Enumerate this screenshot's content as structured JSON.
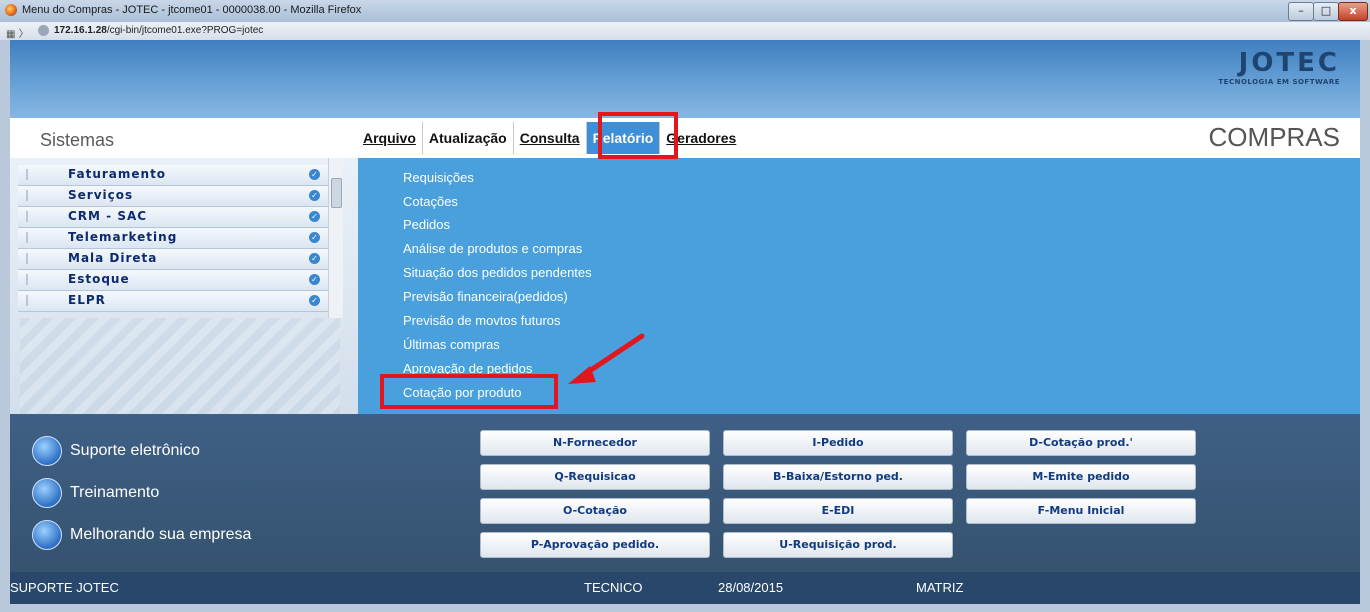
{
  "window": {
    "title": "Menu do Compras - JOTEC - jtcome01 - 0000038.00 - Mozilla Firefox",
    "min_label": "–",
    "max_label": "□",
    "close_label": "x"
  },
  "address": {
    "url_host": "172.16.1.28",
    "url_path": "/cgi-bin/jtcome01.exe?PROG=jotec"
  },
  "brand": {
    "logo": "JOTEC",
    "tagline": "TECNOLOGIA EM SOFTWARE",
    "module": "COMPRAS"
  },
  "sidebar": {
    "title": "Sistemas",
    "items": [
      {
        "label": "Faturamento"
      },
      {
        "label": "Serviços"
      },
      {
        "label": "CRM - SAC"
      },
      {
        "label": "Telemarketing"
      },
      {
        "label": "Mala Direta"
      },
      {
        "label": "Estoque"
      },
      {
        "label": "ELPR"
      }
    ]
  },
  "menu": {
    "items": [
      {
        "label": "Arquivo"
      },
      {
        "label": "Atualização"
      },
      {
        "label": "Consulta"
      },
      {
        "label": "Relatório",
        "active": true
      },
      {
        "label": "Geradores"
      }
    ]
  },
  "dropdown": {
    "items": [
      {
        "label": "Requisições"
      },
      {
        "label": "Cotações"
      },
      {
        "label": "Pedidos"
      },
      {
        "label": "Análise de produtos e compras"
      },
      {
        "label": "Situação dos pedidos pendentes"
      },
      {
        "label": "Previsão financeira(pedidos)"
      },
      {
        "label": "Previsão de movtos futuros"
      },
      {
        "label": "Últimas compras"
      },
      {
        "label": "Aprovação de pedidos"
      },
      {
        "label": "Cotação por produto"
      }
    ]
  },
  "support": {
    "items": [
      {
        "label": "Suporte eletrônico"
      },
      {
        "label": "Treinamento"
      },
      {
        "label": "Melhorando sua empresa"
      }
    ]
  },
  "shortcuts": {
    "col1": [
      "N-Fornecedor",
      "Q-Requisicao",
      "O-Cotação",
      "P-Aprovação pedido."
    ],
    "col2": [
      "I-Pedido",
      "B-Baixa/Estorno ped.",
      "E-EDI",
      "U-Requisição prod."
    ],
    "col3": [
      "D-Cotação prod.'",
      "M-Emite pedido",
      "F-Menu Inicial"
    ]
  },
  "status": {
    "left": "SUPORTE JOTEC",
    "user": "TECNICO",
    "date": "28/08/2015",
    "branch": "MATRIZ"
  },
  "colors": {
    "highlight": "#e2161d",
    "menu_active": "#3c8fd8",
    "dropdown_bg": "#4a9fdd"
  }
}
